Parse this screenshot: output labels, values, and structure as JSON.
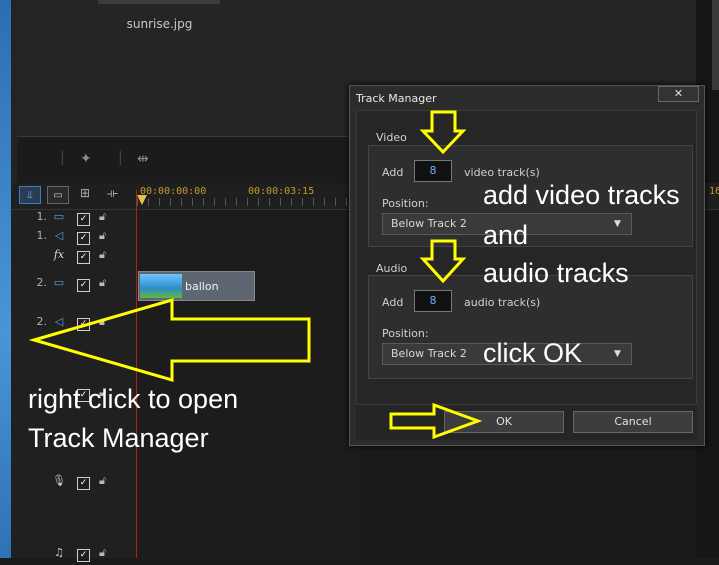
{
  "library": {
    "thumb_label": "sunrise.jpg"
  },
  "timeline": {
    "timecode_start": "00:00:00:00",
    "timecode_mid": "00:00:03:15",
    "timecode_cut": "16",
    "tracks": [
      {
        "num": "1.",
        "kind": "video"
      },
      {
        "num": "1.",
        "kind": "audio"
      },
      {
        "num": "",
        "kind": "fx",
        "label": "fx"
      },
      {
        "num": "2.",
        "kind": "video"
      },
      {
        "num": "2.",
        "kind": "audio"
      }
    ],
    "clip_label": "ballon"
  },
  "dialog": {
    "title": "Track Manager",
    "close": "✕",
    "video_group": "Video",
    "audio_group": "Audio",
    "add_label": "Add",
    "video_count": "8",
    "video_unit": "video track(s)",
    "audio_count": "8",
    "audio_unit": "audio track(s)",
    "position_label": "Position:",
    "video_position": "Below Track 2",
    "audio_position": "Below Track 2",
    "ok": "OK",
    "cancel": "Cancel"
  },
  "annotations": {
    "line1": "add video tracks",
    "line2": "and",
    "line3": "audio tracks",
    "click_ok": "click OK",
    "right_click_1": "right click to open",
    "right_click_2": "Track Manager"
  },
  "colors": {
    "accent": "#3b7bc8",
    "annotation_arrow": "#ffff00",
    "playhead": "#b01e1e"
  }
}
